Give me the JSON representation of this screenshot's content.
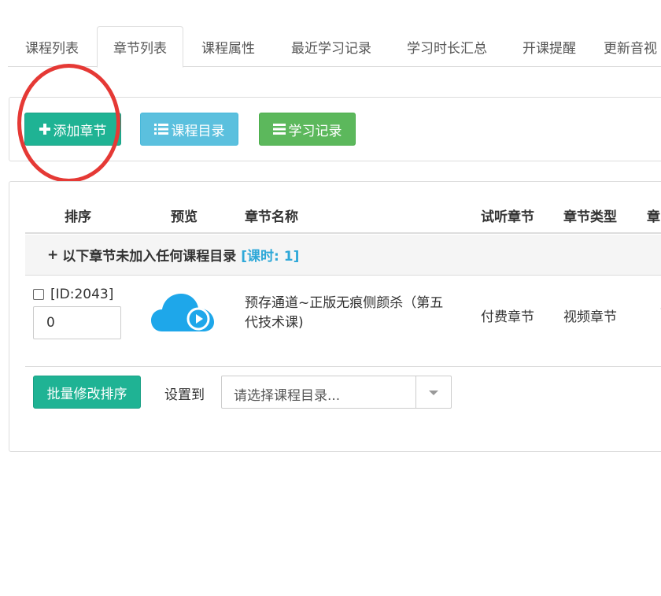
{
  "tabs": [
    {
      "label": "课程列表",
      "active": false
    },
    {
      "label": "章节列表",
      "active": true
    },
    {
      "label": "课程属性",
      "active": false
    },
    {
      "label": "最近学习记录",
      "active": false
    },
    {
      "label": "学习时长汇总",
      "active": false
    },
    {
      "label": "开课提醒",
      "active": false
    },
    {
      "label": "更新音视",
      "active": false
    }
  ],
  "toolbar": {
    "add_label": "添加章节",
    "catalog_label": "课程目录",
    "record_label": "学习记录"
  },
  "table": {
    "headers": [
      "排序",
      "预览",
      "章节名称",
      "试听章节",
      "章节类型",
      "章"
    ],
    "group": {
      "prefix": "+",
      "label": "以下章节未加入任何课程目录",
      "hours": "[课时: 1]"
    },
    "rows": [
      {
        "id": "[ID:2043]",
        "sort": "0",
        "preview_icon": "cloud-play-icon",
        "name": "预存通道~正版无痕侧颜杀（第五代技术课)",
        "trial": "付费章节",
        "type": "视频章节",
        "cut": "1"
      }
    ]
  },
  "footer": {
    "batch_label": "批量修改排序",
    "set_label": "设置到",
    "select_placeholder": "请选择课程目录..."
  },
  "colors": {
    "primary": "#1fb394",
    "info": "#5bc0de",
    "success": "#5cb85c",
    "annotation": "#e53935",
    "hours": "#2ea8d8",
    "cloud": "#1ea7ea"
  }
}
